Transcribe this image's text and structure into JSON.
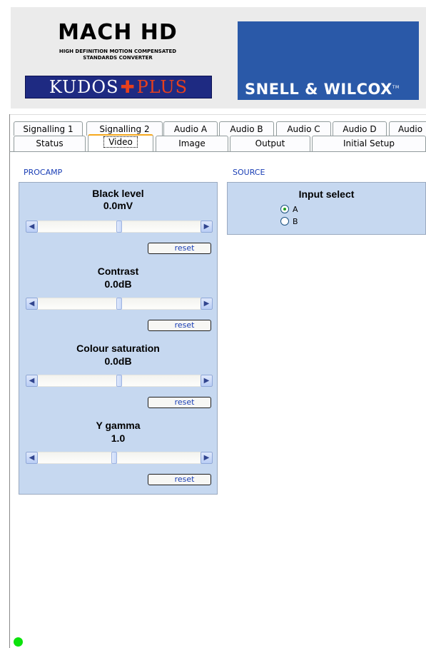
{
  "header": {
    "product_title": "MACH HD",
    "product_subtitle_line1": "HIGH DEFINITION MOTION COMPENSATED",
    "product_subtitle_line2": "STANDARDS CONVERTER",
    "kudos_word": "KUDOS",
    "kudos_plus_word": "PLUS",
    "brand": "SNELL & WILCOX",
    "brand_mark": "TM",
    "brand_color": "#2a59a8",
    "kudos_color": "#1e2a82",
    "plus_color": "#e8401c"
  },
  "tabs": {
    "row1": [
      "Signalling 1",
      "Signalling 2",
      "Audio A",
      "Audio B",
      "Audio C",
      "Audio D",
      "Audio"
    ],
    "row2": [
      "Status",
      "Video",
      "Image",
      "Output",
      "Initial Setup"
    ],
    "active": "Video"
  },
  "procamp": {
    "label": "PROCAMP",
    "controls": [
      {
        "title": "Black level",
        "value": "0.0mV",
        "position": 0.5
      },
      {
        "title": "Contrast",
        "value": "0.0dB",
        "position": 0.5
      },
      {
        "title": "Colour saturation",
        "value": "0.0dB",
        "position": 0.5
      },
      {
        "title": "Y gamma",
        "value": "1.0",
        "position": 0.47
      }
    ],
    "reset_label": "reset"
  },
  "source": {
    "label": "SOURCE",
    "title": "Input select",
    "options": [
      "A",
      "B"
    ],
    "selected": "A"
  },
  "status": {
    "led_color": "#0ce20c"
  },
  "icons": {
    "scroll_left": "◀",
    "scroll_right": "▶"
  }
}
